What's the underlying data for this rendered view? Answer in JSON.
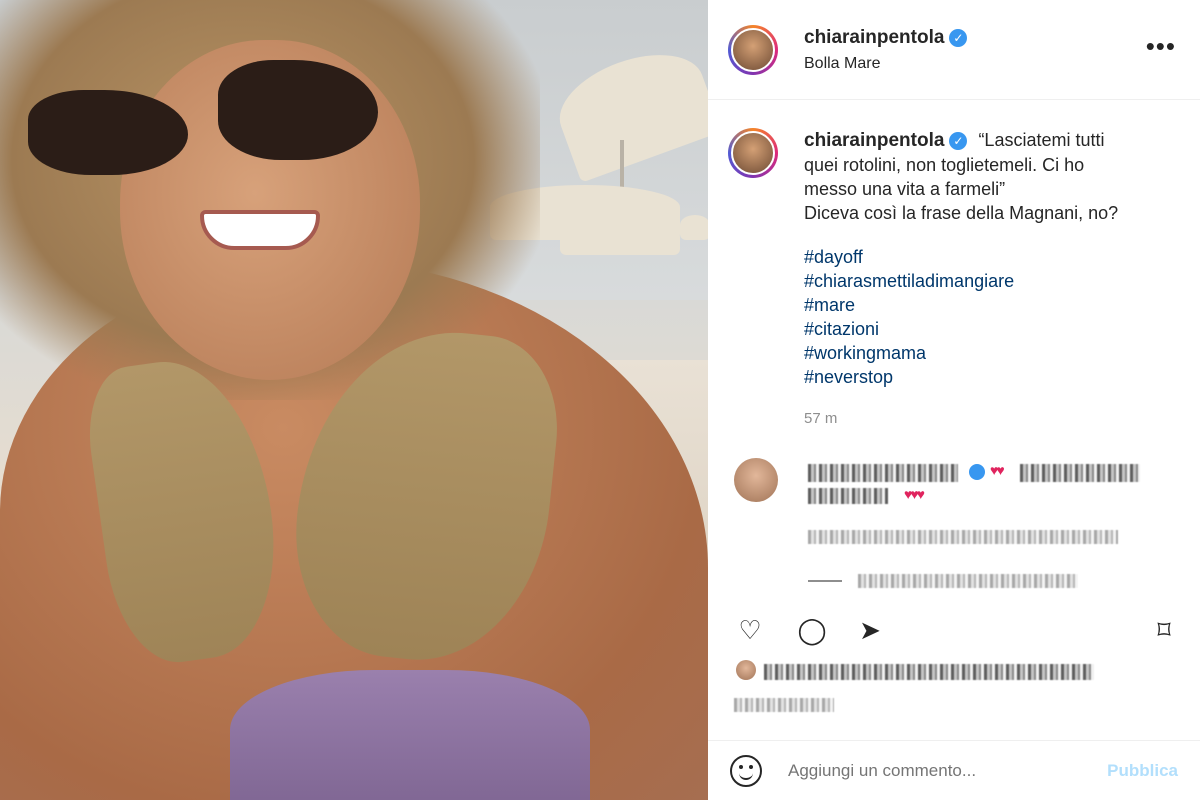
{
  "post": {
    "username": "chiarainpentola",
    "verified_icon": "verified-badge-icon",
    "location": "Bolla Mare",
    "caption_lines": [
      "“Lasciatemi tutti",
      "quei rotolini, non toglietemeli. Ci ho",
      "messo una vita a farmeli”",
      "Diceva così la frase della Magnani, no?"
    ],
    "hashtags": [
      "#dayoff",
      "#chiarasmettiladimangiare",
      "#mare",
      "#citazioni",
      "#workingmama",
      "#neverstop"
    ],
    "timestamp": "57 m"
  },
  "header": {
    "more_label": "•••"
  },
  "composer": {
    "placeholder": "Aggiungi un commento...",
    "publish_label": "Pubblica"
  },
  "colors": {
    "hashtag": "#00376b",
    "verified": "#3897f0",
    "publish_disabled": "#b2dffc",
    "muted": "#8e8e8e"
  }
}
